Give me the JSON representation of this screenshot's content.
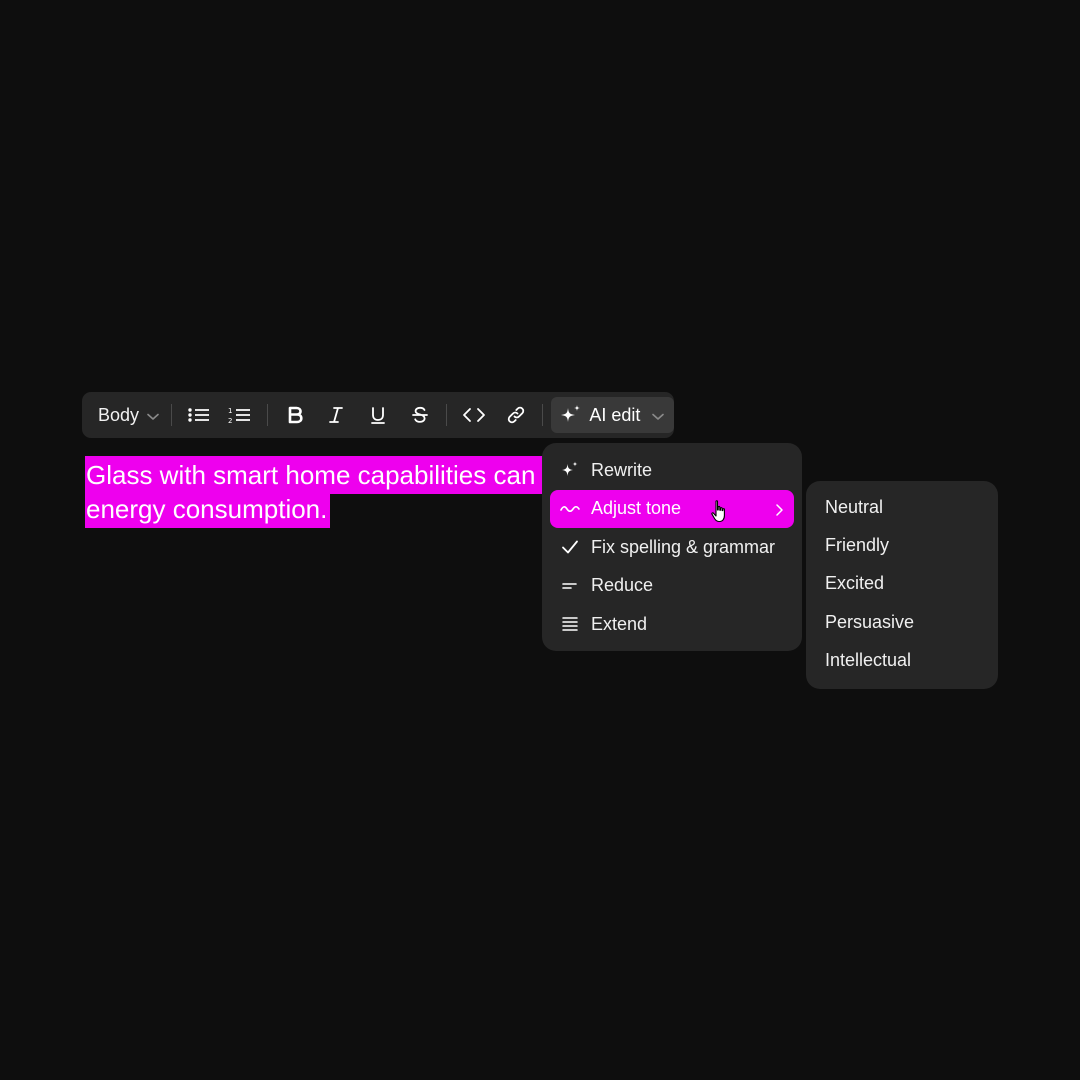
{
  "toolbar": {
    "text_style": "Body",
    "ai_edit_label": "AI edit"
  },
  "editor": {
    "selected_text": "Glass with smart home capabilities can optimize energy consumption."
  },
  "ai_menu": {
    "items": [
      {
        "label": "Rewrite",
        "icon": "sparkle-icon"
      },
      {
        "label": "Adjust tone",
        "icon": "wave-icon",
        "active": true
      },
      {
        "label": "Fix spelling & grammar",
        "icon": "checkmark-icon"
      },
      {
        "label": "Reduce",
        "icon": "short-lines-icon"
      },
      {
        "label": "Extend",
        "icon": "paragraph-lines-icon"
      }
    ]
  },
  "tone_menu": {
    "items": [
      "Neutral",
      "Friendly",
      "Excited",
      "Persuasive",
      "Intellectual"
    ]
  },
  "colors": {
    "background": "#0e0e0e",
    "panel": "#262626",
    "highlight": "#ee00ee"
  }
}
